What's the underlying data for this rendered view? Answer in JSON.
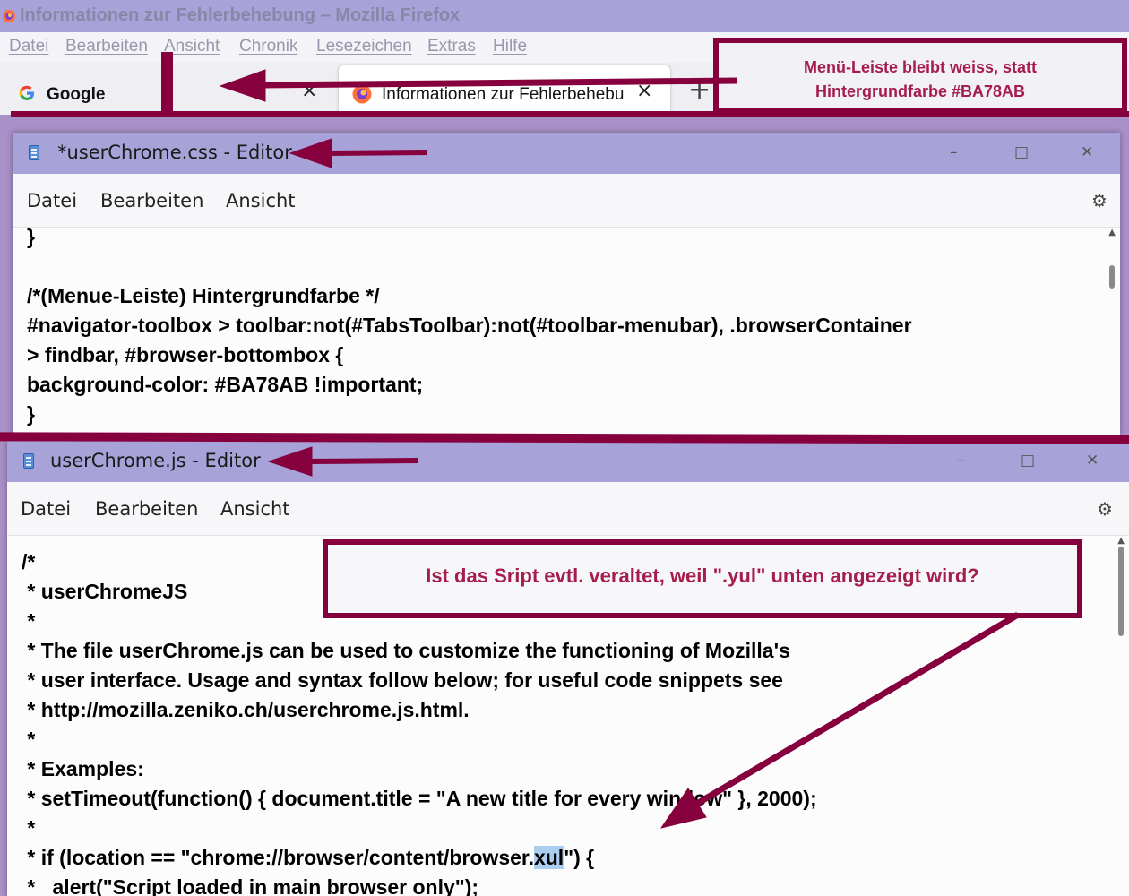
{
  "firefox": {
    "title": "Informationen zur Fehlerbehebung – Mozilla Firefox",
    "menubar": [
      "Datei",
      "Bearbeiten",
      "Ansicht",
      "Chronik",
      "Lesezeichen",
      "Extras",
      "Hilfe"
    ],
    "tabs": [
      {
        "label": "Google",
        "icon": "google-icon",
        "close": "×"
      },
      {
        "label": "Informationen zur Fehlerbehebung",
        "icon": "firefox-icon",
        "close": "×",
        "active": true
      }
    ],
    "new_tab": "+"
  },
  "annotations": {
    "menubar_note_line1": "Menü-Leiste bleibt weiss, statt",
    "menubar_note_line2": "Hintergrundfarbe #BA78AB",
    "script_note": "Ist das Sript evtl. veraltet, weil \".yul\" unten angezeigt wird?",
    "color": "#86003e"
  },
  "editor_css": {
    "title": "*userChrome.css - Editor",
    "menu": [
      "Datei",
      "Bearbeiten",
      "Ansicht"
    ],
    "window_controls": [
      "–",
      "□",
      "✕"
    ],
    "lines": [
      "}",
      "",
      "/*(Menue-Leiste) Hintergrundfarbe */",
      "#navigator-toolbox > toolbar:not(#TabsToolbar):not(#toolbar-menubar), .browserContainer",
      "> findbar, #browser-bottombox {",
      "background-color: #BA78AB !important;",
      "}"
    ]
  },
  "editor_js": {
    "title": "userChrome.js - Editor",
    "menu": [
      "Datei",
      "Bearbeiten",
      "Ansicht"
    ],
    "window_controls": [
      "–",
      "□",
      "✕"
    ],
    "lines": [
      "/*",
      " * userChromeJS",
      " *",
      " * The file userChrome.js can be used to customize the functioning of Mozilla's",
      " * user interface. Usage and syntax follow below; for useful code snippets see",
      " * http://mozilla.zeniko.ch/userchrome.js.html.",
      " *",
      " * Examples:",
      " * setTimeout(function() { document.title = \"A new title for every window\" }, 2000);",
      " *"
    ],
    "highlight_line": {
      "before": " * if (location == \"chrome://browser/content/browser.",
      "highlight": "xul",
      "after": "\") {"
    },
    "last_line": " *   alert(\"Script loaded in main browser only\");"
  },
  "icons": {
    "gear": "gear-icon",
    "notepad": "notepad-icon"
  }
}
